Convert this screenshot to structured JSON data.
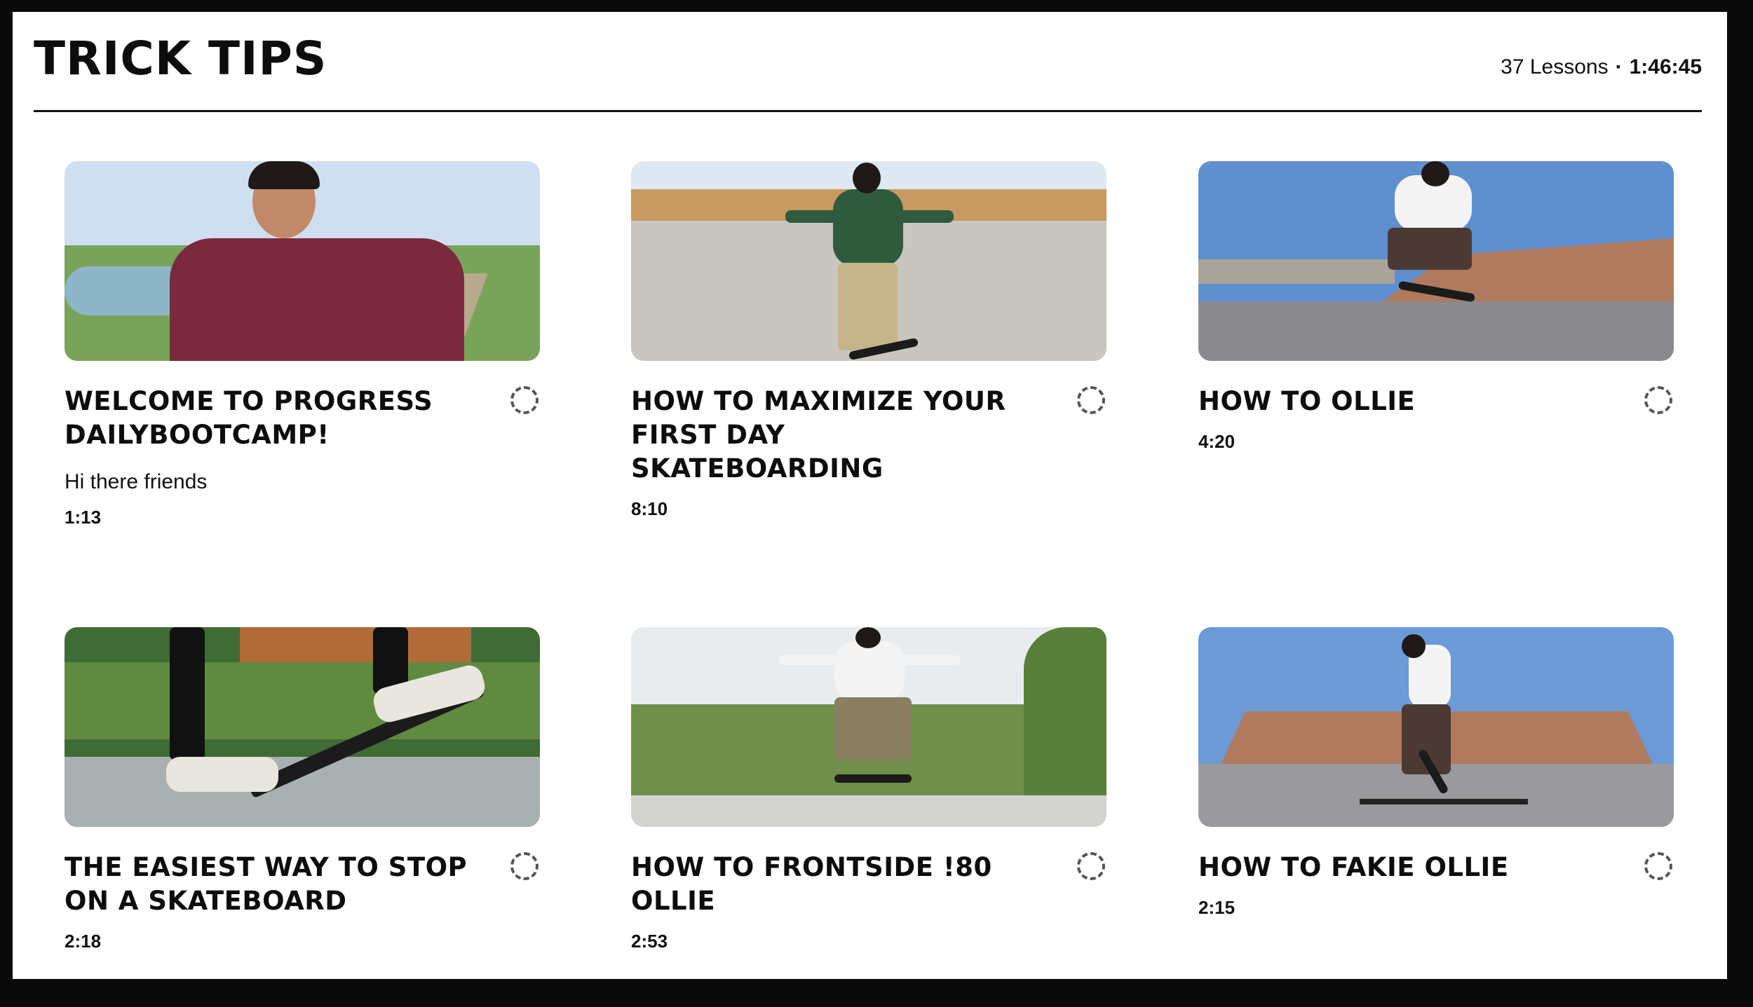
{
  "header": {
    "title": "TRICK TIPS",
    "lessons_count": "37 Lessons",
    "separator": "·",
    "total_duration": "1:46:45"
  },
  "lessons": [
    {
      "title": "WELCOME TO PROGRESS DAILYBOOTCAMP!",
      "description": "Hi there friends",
      "duration": "1:13",
      "status_icon": "dashed-circle-icon",
      "colors": {
        "sky": "#cfdff0",
        "ground": "#7aa35a",
        "shirt": "#7a2a3c"
      }
    },
    {
      "title": "HOW TO MAXIMIZE YOUR FIRST DAY SKATEBOARDING",
      "description": "",
      "duration": "8:10",
      "status_icon": "dashed-circle-icon",
      "colors": {
        "sky": "#dde8f2",
        "ground": "#c9c6c0",
        "shirt": "#2f5a3e"
      }
    },
    {
      "title": "HOW TO OLLIE",
      "description": "",
      "duration": "4:20",
      "status_icon": "dashed-circle-icon",
      "colors": {
        "sky": "#5f8fcf",
        "ground": "#8a8a8c",
        "shirt": "#f4f4f4"
      }
    },
    {
      "title": "THE EASIEST WAY TO STOP ON A SKATEBOARD",
      "description": "",
      "duration": "2:18",
      "status_icon": "dashed-circle-icon",
      "colors": {
        "sky": "#3f6b35",
        "ground": "#a9b0b2",
        "shirt": "#1a1a1a"
      }
    },
    {
      "title": "HOW TO FRONTSIDE !80 OLLIE",
      "description": "",
      "duration": "2:53",
      "status_icon": "dashed-circle-icon",
      "colors": {
        "sky": "#e8ecef",
        "ground": "#6f8f4a",
        "shirt": "#f4f4f4"
      }
    },
    {
      "title": "HOW TO FAKIE OLLIE",
      "description": "",
      "duration": "2:15",
      "status_icon": "dashed-circle-icon",
      "colors": {
        "sky": "#6b9ad6",
        "ground": "#9a9a9c",
        "shirt": "#f4f4f4"
      }
    }
  ]
}
